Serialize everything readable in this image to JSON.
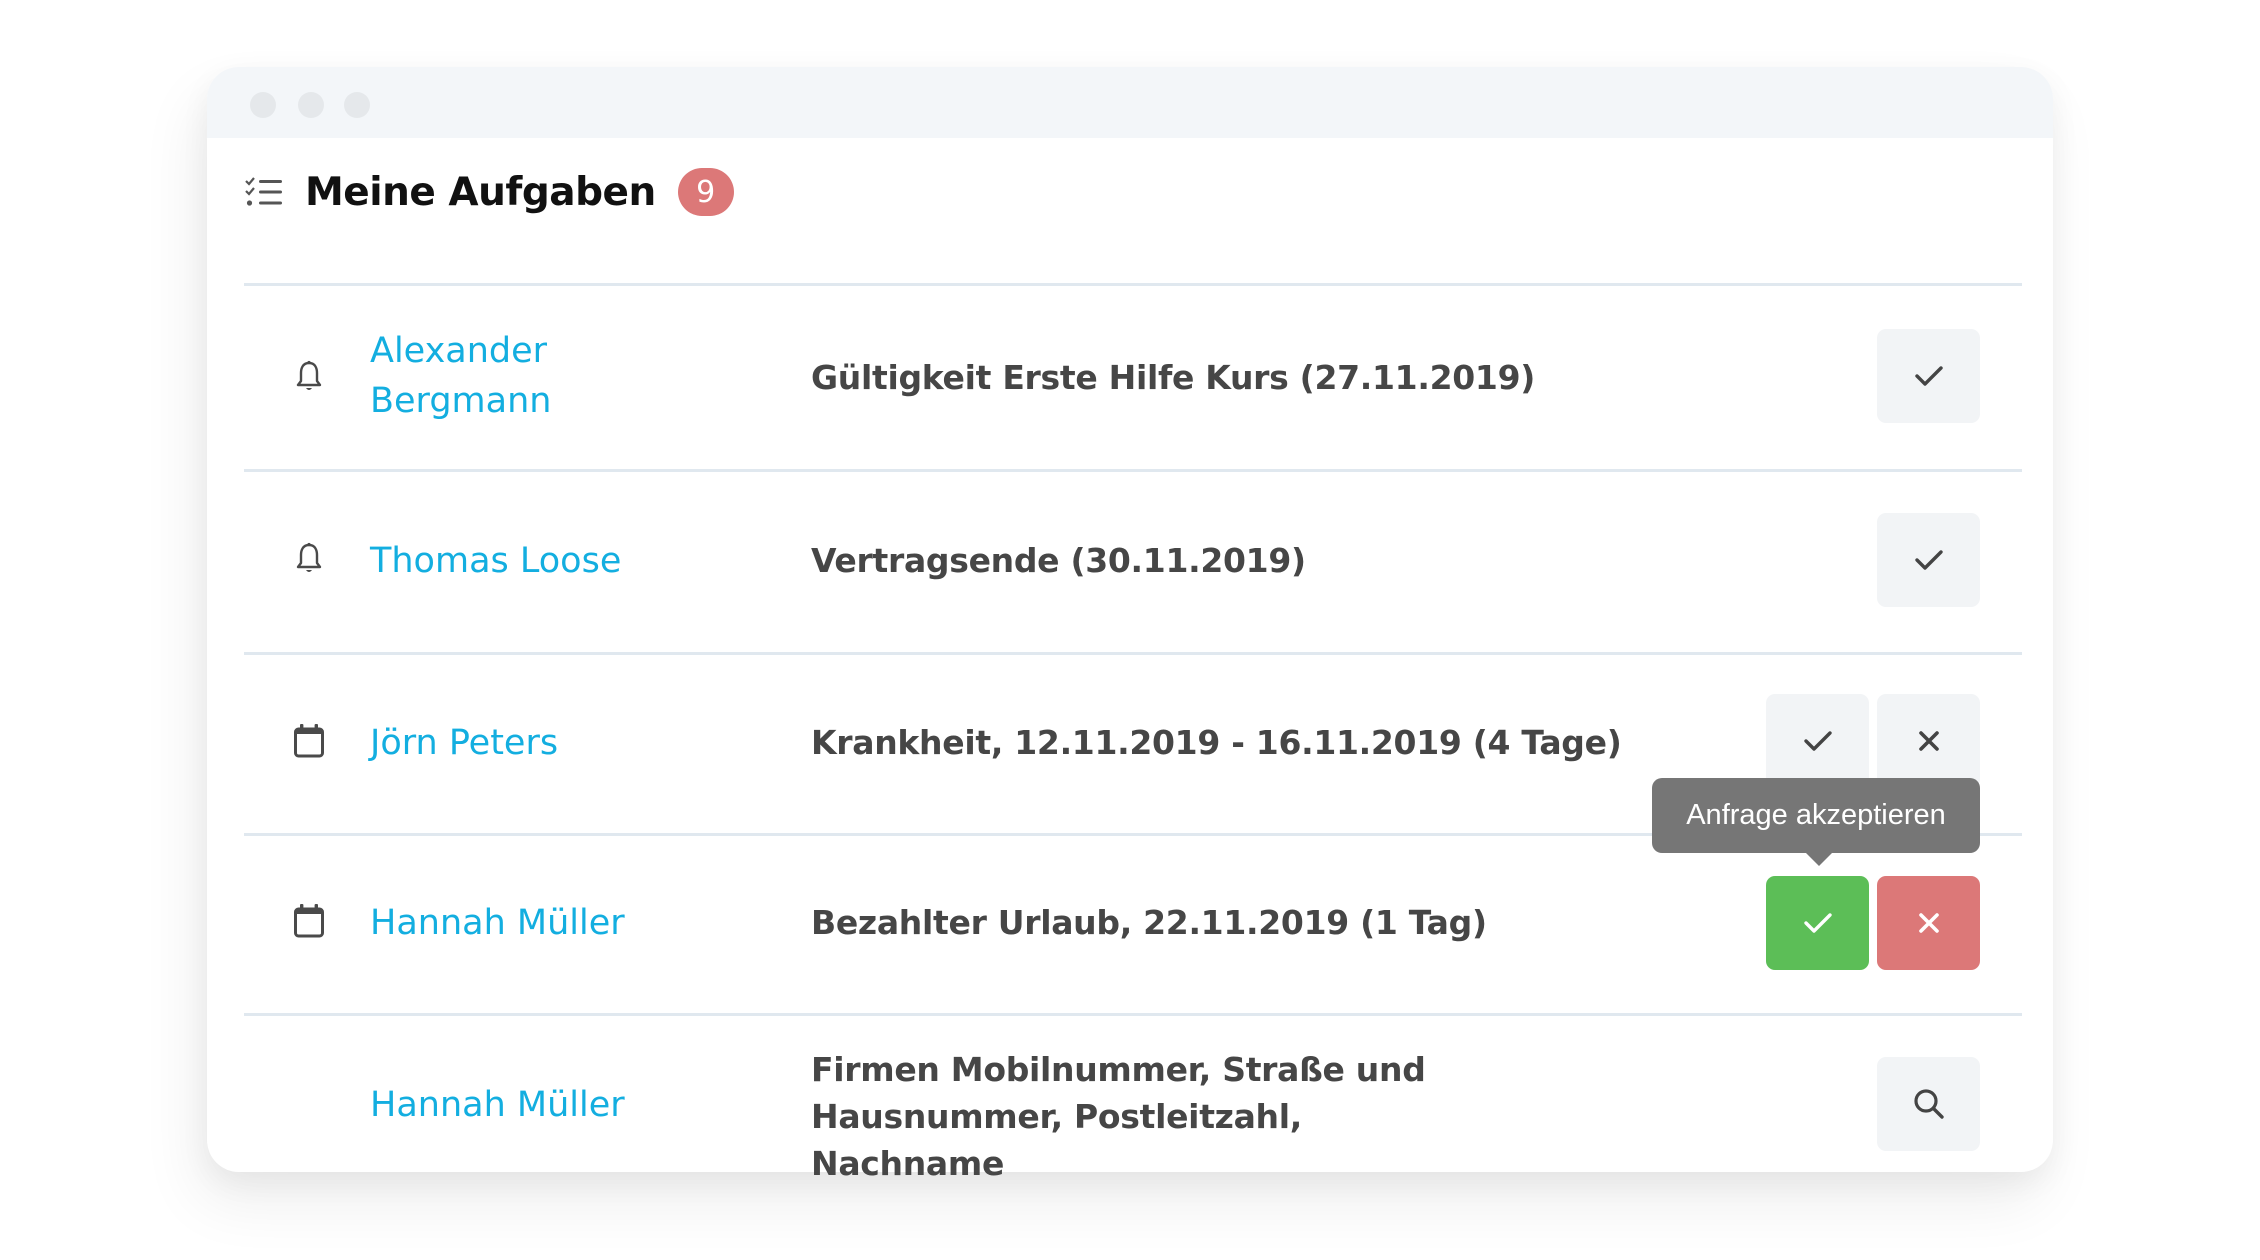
{
  "window": {
    "titlebar_dots": [
      "window-dot-1",
      "window-dot-2",
      "window-dot-3"
    ]
  },
  "header": {
    "icon": "checklist-icon",
    "title": "Meine Aufgaben",
    "badge_count": "9"
  },
  "colors": {
    "link": "#13aee0",
    "badge": "#dc7878",
    "accept": "#5cbe57",
    "reject": "#dc7878",
    "tooltip": "#767676",
    "button_bg": "#f2f4f6"
  },
  "tasks": [
    {
      "icon": "bell-icon",
      "name": "Alexander Bergmann",
      "description": "Gültigkeit Erste Hilfe Kurs (27.11.2019)",
      "actions": [
        "check-icon"
      ]
    },
    {
      "icon": "bell-icon",
      "name": "Thomas Loose",
      "description": "Vertragsende (30.11.2019)",
      "actions": [
        "check-icon"
      ]
    },
    {
      "icon": "calendar-icon",
      "name": "Jörn Peters",
      "description": "Krankheit, 12.11.2019 - 16.11.2019 (4 Tage)",
      "actions": [
        "check-icon",
        "close-icon"
      ]
    },
    {
      "icon": "calendar-icon",
      "name": "Hannah Müller",
      "description": "Bezahlter Urlaub, 22.11.2019 (1 Tag)",
      "actions": [
        "check-icon",
        "close-icon"
      ],
      "highlighted": true
    },
    {
      "icon": "",
      "name": "Hannah Müller",
      "description": "Firmen Mobilnummer, Straße und Hausnummer, Postleitzahl, Nachname",
      "actions": [
        "search-icon"
      ]
    }
  ],
  "tooltip": {
    "text": "Anfrage akzeptieren"
  }
}
